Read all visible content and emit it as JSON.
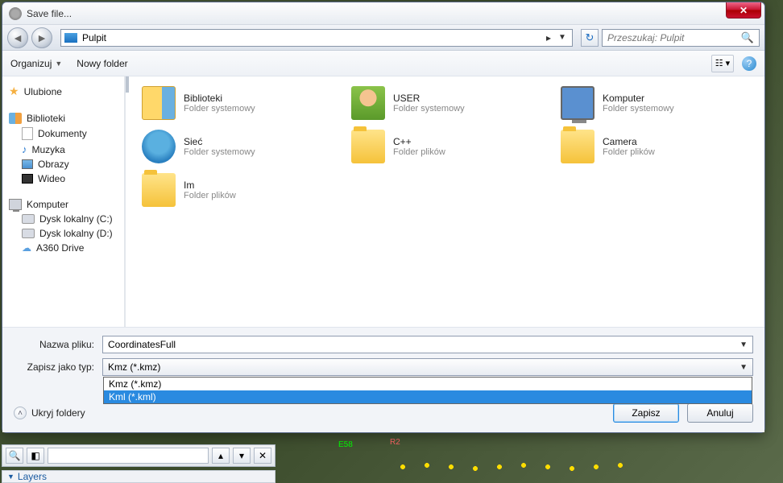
{
  "window": {
    "title": "Save file..."
  },
  "nav": {
    "location_icon": "desktop-icon",
    "location": "Pulpit",
    "chevron": "▸",
    "search_placeholder": "Przeszukaj: Pulpit"
  },
  "toolbar": {
    "organize": "Organizuj",
    "new_folder": "Nowy folder"
  },
  "sidebar": {
    "favorites": "Ulubione",
    "libraries": "Biblioteki",
    "lib_items": [
      "Dokumenty",
      "Muzyka",
      "Obrazy",
      "Wideo"
    ],
    "computer": "Komputer",
    "drives": [
      "Dysk lokalny (C:)",
      "Dysk lokalny (D:)",
      "A360 Drive"
    ]
  },
  "files": [
    {
      "name": "Biblioteki",
      "sub": "Folder systemowy",
      "ico": "lib-big"
    },
    {
      "name": "USER",
      "sub": "Folder systemowy",
      "ico": "user-big"
    },
    {
      "name": "Komputer",
      "sub": "Folder systemowy",
      "ico": "computer-big"
    },
    {
      "name": "Sieć",
      "sub": "Folder systemowy",
      "ico": "net-big"
    },
    {
      "name": "C++",
      "sub": "Folder plików",
      "ico": "folder-ico"
    },
    {
      "name": "Camera",
      "sub": "Folder plików",
      "ico": "folder-ico"
    },
    {
      "name": "Im",
      "sub": "Folder plików",
      "ico": "folder-ico"
    }
  ],
  "form": {
    "filename_label": "Nazwa pliku:",
    "filename_value": "CoordinatesFull",
    "filetype_label": "Zapisz jako typ:",
    "filetype_selected": "Kmz (*.kmz)",
    "filetype_options": [
      "Kmz (*.kmz)",
      "Kml (*.kml)"
    ],
    "selected_option_index": 1
  },
  "actions": {
    "hide_folders": "Ukryj foldery",
    "save": "Zapisz",
    "cancel": "Anuluj"
  },
  "map": {
    "tag1": "E58",
    "tag2": "R2"
  },
  "app": {
    "layers": "Layers"
  }
}
